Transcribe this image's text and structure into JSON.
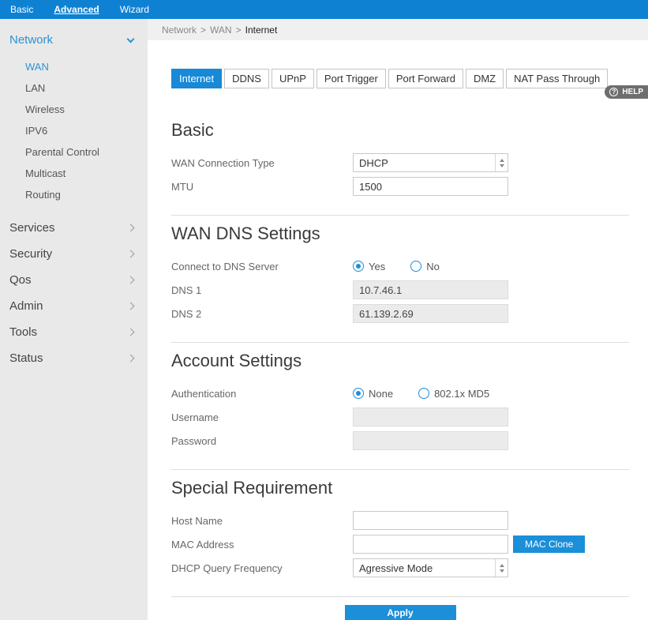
{
  "topbar": {
    "basic": "Basic",
    "advanced": "Advanced",
    "wizard": "Wizard"
  },
  "sidebar": {
    "network_label": "Network",
    "network_items": [
      "WAN",
      "LAN",
      "Wireless",
      "IPV6",
      "Parental Control",
      "Multicast",
      "Routing"
    ],
    "groups": [
      "Services",
      "Security",
      "Qos",
      "Admin",
      "Tools",
      "Status"
    ]
  },
  "breadcrumb": {
    "root": "Network",
    "sep": ">",
    "parent": "WAN",
    "current": "Internet"
  },
  "tabs": [
    "Internet",
    "DDNS",
    "UPnP",
    "Port Trigger",
    "Port Forward",
    "DMZ",
    "NAT Pass Through"
  ],
  "help": {
    "label": "HELP",
    "icon": "?"
  },
  "basic": {
    "title": "Basic",
    "wan_type_label": "WAN Connection Type",
    "wan_type_value": "DHCP",
    "mtu_label": "MTU",
    "mtu_value": "1500"
  },
  "dns": {
    "title": "WAN DNS Settings",
    "connect_label": "Connect to DNS Server",
    "yes": "Yes",
    "no": "No",
    "dns1_label": "DNS 1",
    "dns1_value": "10.7.46.1",
    "dns2_label": "DNS 2",
    "dns2_value": "61.139.2.69"
  },
  "account": {
    "title": "Account Settings",
    "auth_label": "Authentication",
    "none": "None",
    "md5": "802.1x MD5",
    "username_label": "Username",
    "password_label": "Password"
  },
  "special": {
    "title": "Special Requirement",
    "host_label": "Host Name",
    "mac_label": "MAC Address",
    "mac_clone": "MAC Clone",
    "freq_label": "DHCP Query Frequency",
    "freq_value": "Agressive Mode"
  },
  "apply_label": "Apply",
  "colors": {
    "accent": "#1b8fd8",
    "topbar": "#0f81d3",
    "link": "#2a93d5"
  }
}
